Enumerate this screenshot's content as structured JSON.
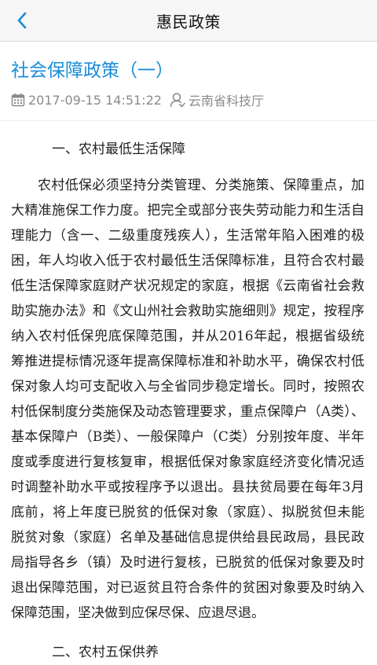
{
  "navbar": {
    "title": "惠民政策",
    "back_icon": "chevron-left-icon"
  },
  "article": {
    "title": "社会保障政策（一）",
    "datetime": "2017-09-15 14:51:22",
    "author": "云南省科技厅",
    "date_icon": "calendar-icon",
    "author_icon": "user-icon"
  },
  "content": {
    "section1_heading": "一、农村最低生活保障",
    "section1_body": "农村低保必须坚持分类管理、分类施策、保障重点，加大精准施保工作力度。把完全或部分丧失劳动能力和生活自理能力（含一、二级重度残疾人），生活常年陷入困难的极困，年人均收入低于农村最低生活保障标准，且符合农村最低生活保障家庭财产状况规定的家庭，根据《云南省社会救助实施办法》和《文山州社会救助实施细则》规定，按程序纳入农村低保兜底保障范围，并从2016年起，根据省级统筹推进提标情况逐年提高保障标准和补助水平，确保农村低保对象人均可支配收入与全省同步稳定增长。同时，按照农村低保制度分类施保及动态管理要求，重点保障户（A类）、基本保障户（B类）、一般保障户（C类）分别按年度、半年度或季度进行复核复审，根据低保对象家庭经济变化情况适时调整补助水平或按程序予以退出。县扶贫局要在每年3月底前，将上年度已脱贫的低保对象（家庭）、拟脱贫但未能脱贫对象（家庭）名单及基础信息提供给县民政局，县民政局指导各乡（镇）及时进行复核，已脱贫的低保对象要及时退出保障范围，对已返贫且符合条件的贫困对象要及时纳入保障范围，坚决做到应保尽保、应退尽退。",
    "section2_heading": "二、农村五保供养"
  },
  "colors": {
    "accent": "#1a8cd8",
    "meta": "#8a8a8a",
    "navbar_bg": "#f6f6f6"
  }
}
